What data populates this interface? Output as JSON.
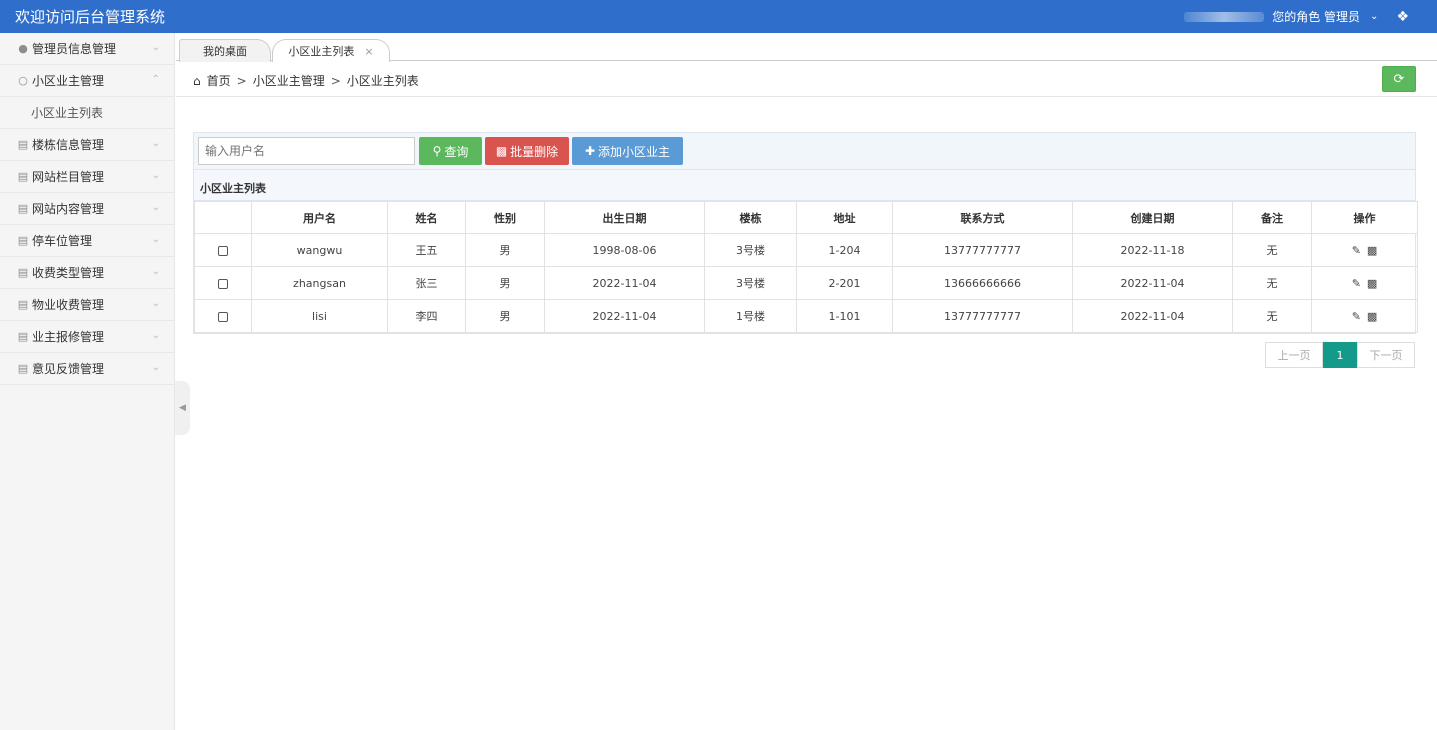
{
  "header": {
    "title": "欢迎访问后台管理系统",
    "role_text": "您的角色 管理员",
    "dropdown_icon": "chevron-down-icon",
    "skin_icon": "shirt-icon"
  },
  "sidebar": {
    "items": [
      {
        "label": "管理员信息管理",
        "icon": "user-icon"
      },
      {
        "label": "小区业主管理",
        "icon": "user-outline-icon"
      },
      {
        "label": "小区业主列表"
      },
      {
        "label": "楼栋信息管理",
        "icon": "list-icon"
      },
      {
        "label": "网站栏目管理",
        "icon": "list-icon"
      },
      {
        "label": "网站内容管理",
        "icon": "list-icon"
      },
      {
        "label": "停车位管理",
        "icon": "list-icon"
      },
      {
        "label": "收费类型管理",
        "icon": "list-icon"
      },
      {
        "label": "物业收费管理",
        "icon": "list-icon"
      },
      {
        "label": "业主报修管理",
        "icon": "list-icon"
      },
      {
        "label": "意见反馈管理",
        "icon": "list-icon"
      }
    ]
  },
  "tabs": {
    "home": "我的桌面",
    "active": "小区业主列表",
    "close": "×"
  },
  "breadcrumb": {
    "home": "首页",
    "sep": ">",
    "level1": "小区业主管理",
    "level2": "小区业主列表"
  },
  "toolbar": {
    "search_placeholder": "输入用户名",
    "query_label": "查询",
    "batch_delete_label": "批量删除",
    "add_label": "添加小区业主"
  },
  "table": {
    "title": "小区业主列表",
    "columns": [
      "",
      "用户名",
      "姓名",
      "性别",
      "出生日期",
      "楼栋",
      "地址",
      "联系方式",
      "创建日期",
      "备注",
      "操作"
    ],
    "rows": [
      {
        "username": "wangwu",
        "name": "王五",
        "gender": "男",
        "birth": "1998-08-06",
        "building": "3号楼",
        "address": "1-204",
        "phone": "13777777777",
        "created": "2022-11-18",
        "note": "无"
      },
      {
        "username": "zhangsan",
        "name": "张三",
        "gender": "男",
        "birth": "2022-11-04",
        "building": "3号楼",
        "address": "2-201",
        "phone": "13666666666",
        "created": "2022-11-04",
        "note": "无"
      },
      {
        "username": "lisi",
        "name": "李四",
        "gender": "男",
        "birth": "2022-11-04",
        "building": "1号楼",
        "address": "1-101",
        "phone": "13777777777",
        "created": "2022-11-04",
        "note": "无"
      }
    ]
  },
  "pagination": {
    "prev": "上一页",
    "current": "1",
    "next": "下一页"
  }
}
